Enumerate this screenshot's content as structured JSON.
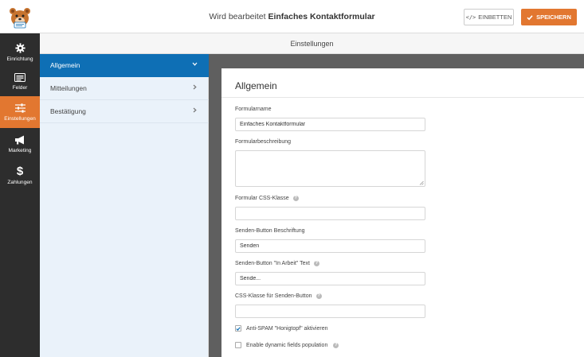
{
  "header": {
    "editing_prefix": "Wird bearbeitet",
    "form_name": "Einfaches Kontaktformular",
    "embed_label": "EINBETTEN",
    "save_label": "SPEICHERN",
    "accent_color": "#e27730"
  },
  "sidebar": {
    "items": [
      {
        "label": "Einrichtung",
        "icon": "gear-icon"
      },
      {
        "label": "Felder",
        "icon": "fields-icon"
      },
      {
        "label": "Einstellungen",
        "icon": "sliders-icon",
        "active": true
      },
      {
        "label": "Marketing",
        "icon": "megaphone-icon"
      },
      {
        "label": "Zahlungen",
        "icon": "dollar-icon"
      }
    ]
  },
  "section_title": "Einstellungen",
  "settings_nav": {
    "items": [
      {
        "label": "Allgemein",
        "active": true
      },
      {
        "label": "Mitteilungen"
      },
      {
        "label": "Bestätigung"
      }
    ],
    "active_color": "#0e6fb5"
  },
  "panel": {
    "title": "Allgemein",
    "form_name": {
      "label": "Formularname",
      "value": "Einfaches Kontaktformular"
    },
    "form_description": {
      "label": "Formularbeschreibung",
      "value": ""
    },
    "css_class": {
      "label": "Formular CSS-Klasse",
      "value": ""
    },
    "submit_text": {
      "label": "Senden-Button Beschriftung",
      "value": "Senden"
    },
    "processing_text": {
      "label": "Senden-Button \"In Arbeit\" Text",
      "value": "Sende..."
    },
    "submit_css": {
      "label": "CSS-Klasse für Senden-Button",
      "value": ""
    },
    "honeypot": {
      "label": "Anti-SPAM \"Honigtopf\" aktivieren",
      "checked": true
    },
    "dynamic_fields": {
      "label": "Enable dynamic fields population",
      "checked": false
    }
  }
}
